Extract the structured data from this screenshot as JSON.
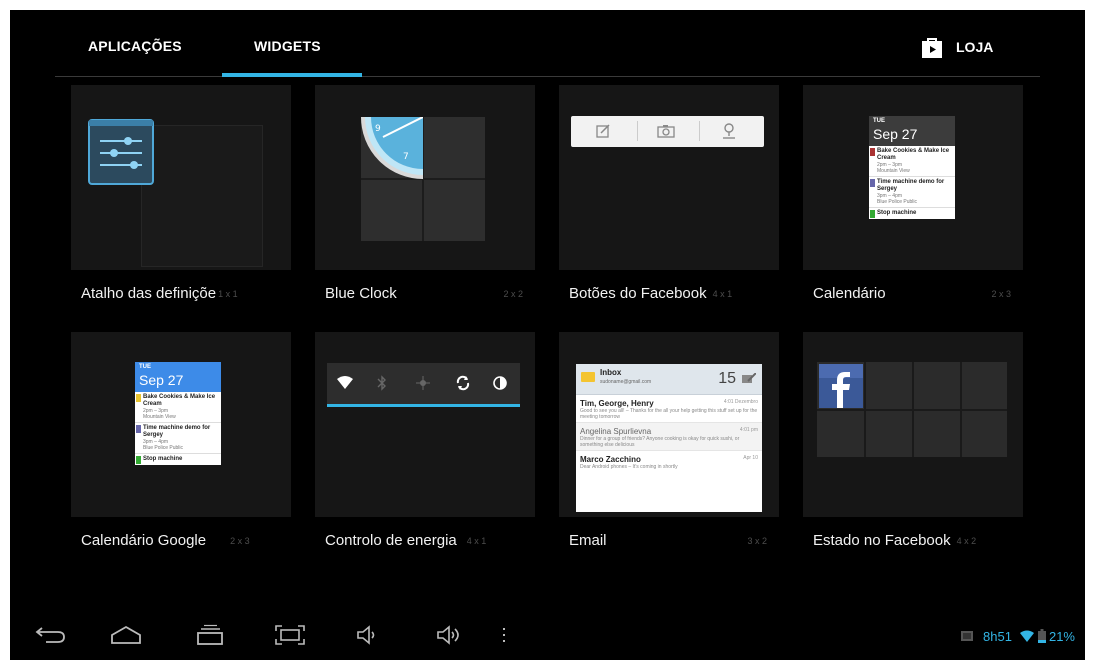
{
  "tabs": [
    {
      "label": "APLICAÇÕES",
      "active": false
    },
    {
      "label": "WIDGETS",
      "active": true
    }
  ],
  "store": {
    "label": "LOJA",
    "icon": "store-bag-icon"
  },
  "colors": {
    "accent": "#33b5e5",
    "background": "#000000",
    "tile": "#161616"
  },
  "widgets": [
    {
      "name": "Atalho das definiçõe",
      "size": "1 x 1"
    },
    {
      "name": "Blue Clock",
      "size": "2 x 2"
    },
    {
      "name": "Botões do Facebook",
      "size": "4 x 1"
    },
    {
      "name": "Calendário",
      "size": "2 x 3"
    },
    {
      "name": "Calendário Google",
      "size": "2 x 3"
    },
    {
      "name": "Controlo de energia",
      "size": "4 x 1"
    },
    {
      "name": "Email",
      "size": "3 x 2"
    },
    {
      "name": "Estado no Facebook",
      "size": "4 x 2"
    }
  ],
  "calendar_preview": {
    "day_of_week": "TUE",
    "date": "Sep 27",
    "events": [
      {
        "title": "Bake Cookies & Make Ice Cream",
        "time": "2pm – 3pm",
        "place": "Mountain View",
        "color": "#a33"
      },
      {
        "title": "Time machine demo for Sergey",
        "time": "3pm – 4pm",
        "place": "Blue Police Public",
        "color": "#66a"
      },
      {
        "title": "Stop machine",
        "time": "",
        "place": "",
        "color": "#3a3"
      }
    ]
  },
  "email_preview": {
    "folder": "Inbox",
    "account": "sudoname@gmail.com",
    "count": "15",
    "messages": [
      {
        "from": "Tim, George, Henry",
        "time": "4:01 Dezembro",
        "snippet": "Good to see you all! – Thanks for the all your help getting this stuff set up for the meeting tomorrow"
      },
      {
        "from": "Angelina Spurlievna",
        "time": "4:01 pm",
        "snippet": "Dinner for a group of friends? Anyone cooking is okay for quick sushi, or something else delicious"
      },
      {
        "from": "Marco Zacchino",
        "time": "Apr 10",
        "snippet": "Dear Android phones – It's coming in shortly"
      }
    ]
  },
  "status_bar": {
    "time": "8h51",
    "battery": "21%"
  },
  "nav": [
    "back-icon",
    "home-icon",
    "recent-apps-icon",
    "screenshot-icon",
    "volume-down-icon",
    "volume-up-icon",
    "menu-dots-icon"
  ]
}
